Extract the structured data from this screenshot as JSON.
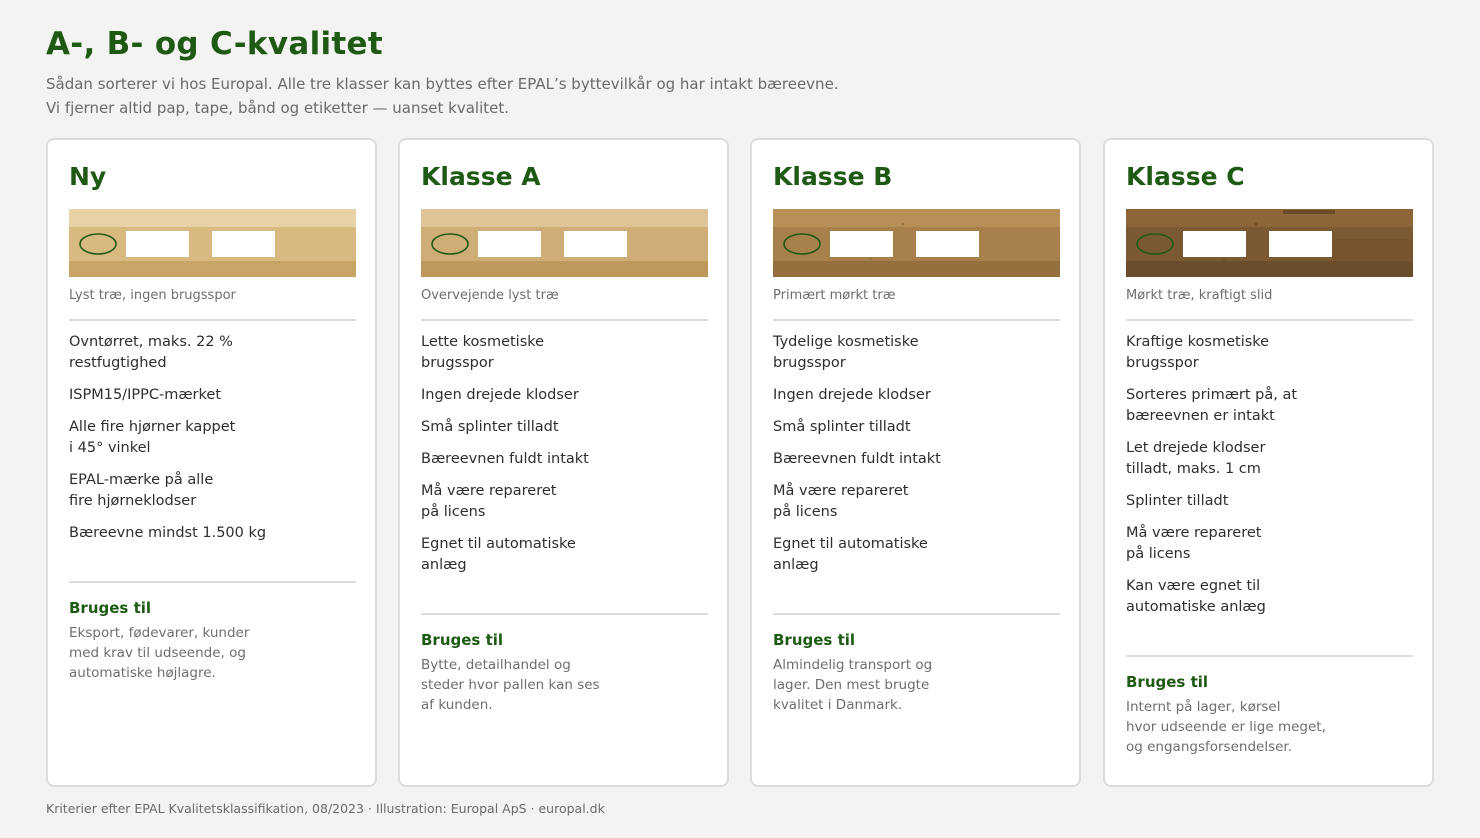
{
  "header": {
    "title": "A-, B- og C-kvalitet",
    "intro_line1": "Sådan sorterer vi hos Europal. Alle tre klasser kan byttes efter EPAL’s byttevilkår og har intakt bæreevne.",
    "intro_line2": "Vi fjerner altid pap, tape, bånd og etiketter — uanset kvalitet."
  },
  "cards": [
    {
      "title": "Ny",
      "caption": "Lyst træ, ingen brugsspor",
      "colors": {
        "top": "#e8d3a6",
        "mid": "#d8b97f",
        "bottom": "#c9a565"
      },
      "criteria": [
        "Ovntørret, maks. 22 %\nrestfugtighed",
        "ISPM15/IPPC-mærket",
        "Alle fire hjørner kappet\ni 45° vinkel",
        "EPAL-mærke på alle\nfire hjørneklodser",
        "Bæreevne mindst 1.500 kg"
      ],
      "use_title": "Bruges til",
      "use_text": "Eksport, fødevarer, kunder\nmed krav til udseende, og\nautomatiske højlagre."
    },
    {
      "title": "Klasse A",
      "caption": "Overvejende lyst træ",
      "colors": {
        "top": "#dfc498",
        "mid": "#cead76",
        "bottom": "#bf995b"
      },
      "criteria": [
        "Lette kosmetiske\nbrugsspor",
        "Ingen drejede klodser",
        "Små splinter tilladt",
        "Bæreevnen fuldt intakt",
        "Må være repareret\npå licens",
        "Egnet til automatiske\nanlæg"
      ],
      "use_title": "Bruges til",
      "use_text": "Bytte, detailhandel og\nsteder hvor pallen kan ses\naf kunden."
    },
    {
      "title": "Klasse B",
      "caption": "Primært mørkt træ",
      "colors": {
        "top": "#b98f58",
        "mid": "#a7804b",
        "bottom": "#95703e"
      },
      "criteria": [
        "Tydelige kosmetiske\nbrugsspor",
        "Ingen drejede klodser",
        "Små splinter tilladt",
        "Bæreevnen fuldt intakt",
        "Må være repareret\npå licens",
        "Egnet til automatiske\nanlæg"
      ],
      "use_title": "Bruges til",
      "use_text": "Almindelig transport og\nlager. Den mest brugte\nkvalitet i Danmark."
    },
    {
      "title": "Klasse C",
      "caption": "Mørkt træ, kraftigt slid",
      "colors": {
        "top": "#8d6538",
        "mid": "#7b5a33",
        "bottom": "#6b4d2b"
      },
      "criteria": [
        "Kraftige kosmetiske\nbrugsspor",
        "Sorteres primært på, at\nbæreevnen er intakt",
        "Let drejede klodser\ntilladt, maks. 1 cm",
        "Splinter tilladt",
        "Må være repareret\npå licens",
        "Kan være egnet til\nautomatiske anlæg"
      ],
      "use_title": "Bruges til",
      "use_text": "Internt på lager, kørsel\nhvor udseende er lige meget,\nog engangsforsendelser."
    }
  ],
  "accent_color": "#1f5a14",
  "footer": "Kriterier efter EPAL Kvalitetsklassifikation, 08/2023 · Illustration: Europal ApS · europal.dk"
}
